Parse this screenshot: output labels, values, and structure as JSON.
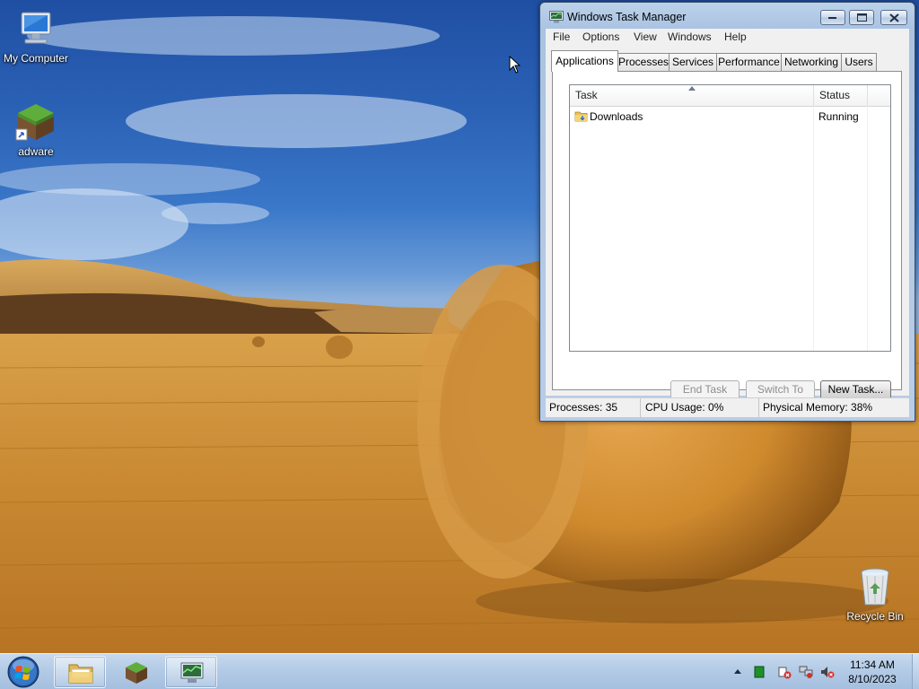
{
  "desktop": {
    "icons": [
      {
        "name": "my-computer",
        "label": "My Computer"
      },
      {
        "name": "adware",
        "label": "adware"
      },
      {
        "name": "recycle-bin",
        "label": "Recycle Bin"
      }
    ]
  },
  "taskmgr": {
    "title": "Windows Task Manager",
    "menu": [
      "File",
      "Options",
      "View",
      "Windows",
      "Help"
    ],
    "tabs": [
      "Applications",
      "Processes",
      "Services",
      "Performance",
      "Networking",
      "Users"
    ],
    "active_tab": "Applications",
    "columns": [
      "Task",
      "Status"
    ],
    "rows": [
      {
        "task": "Downloads",
        "status": "Running",
        "icon": "folder-icon"
      }
    ],
    "buttons": {
      "end_task": "End Task",
      "switch_to": "Switch To",
      "new_task": "New Task..."
    },
    "status": {
      "processes": "Processes: 35",
      "cpu": "CPU Usage: 0%",
      "memory": "Physical Memory: 38%"
    }
  },
  "taskbar": {
    "items": [
      "file-explorer",
      "adware",
      "task-manager"
    ],
    "clock": {
      "time": "11:34 AM",
      "date": "8/10/2023"
    },
    "tray_icons": [
      "show-hidden-icons",
      "app-tray-icon",
      "action-center-icon",
      "network-icon",
      "volume-muted-icon"
    ]
  },
  "colors": {
    "sky": "#2c63b7",
    "field": "#c9892f",
    "taskbar": "#b3cbe6",
    "window_frame": "#a9c3e2"
  }
}
